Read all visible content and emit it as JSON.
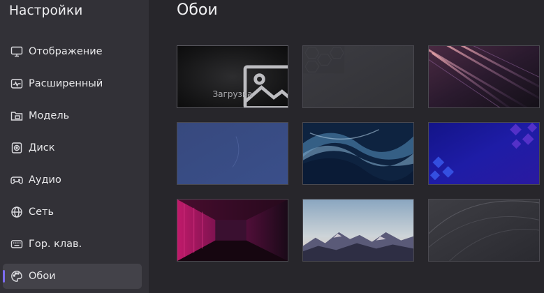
{
  "sidebar": {
    "title": "Настройки",
    "items": [
      {
        "label": "Отображение",
        "icon": "monitor-icon"
      },
      {
        "label": "Расширенный",
        "icon": "activity-icon"
      },
      {
        "label": "Модель",
        "icon": "folder-icon"
      },
      {
        "label": "Диск",
        "icon": "disk-icon"
      },
      {
        "label": "Аудио",
        "icon": "gamepad-icon"
      },
      {
        "label": "Сеть",
        "icon": "globe-icon"
      },
      {
        "label": "Гор. клав.",
        "icon": "keyboard-icon"
      },
      {
        "label": "Обои",
        "icon": "palette-icon",
        "active": true
      }
    ]
  },
  "main": {
    "title": "Обои",
    "upload_label": "Загрузка",
    "wallpapers": [
      {
        "name": "upload",
        "type": "upload-tile"
      },
      {
        "name": "dark-gray-hexagons"
      },
      {
        "name": "light-streaks-purple"
      },
      {
        "name": "blue-plain"
      },
      {
        "name": "blue-liquid-waves"
      },
      {
        "name": "blue-purple-squares"
      },
      {
        "name": "magenta-corridor"
      },
      {
        "name": "mountains-sunset"
      },
      {
        "name": "gray-curves"
      }
    ]
  },
  "colors": {
    "sidebar_bg": "#323137",
    "main_bg": "#27262b",
    "active_bg": "#434249",
    "accent": "#7c6cf0"
  }
}
